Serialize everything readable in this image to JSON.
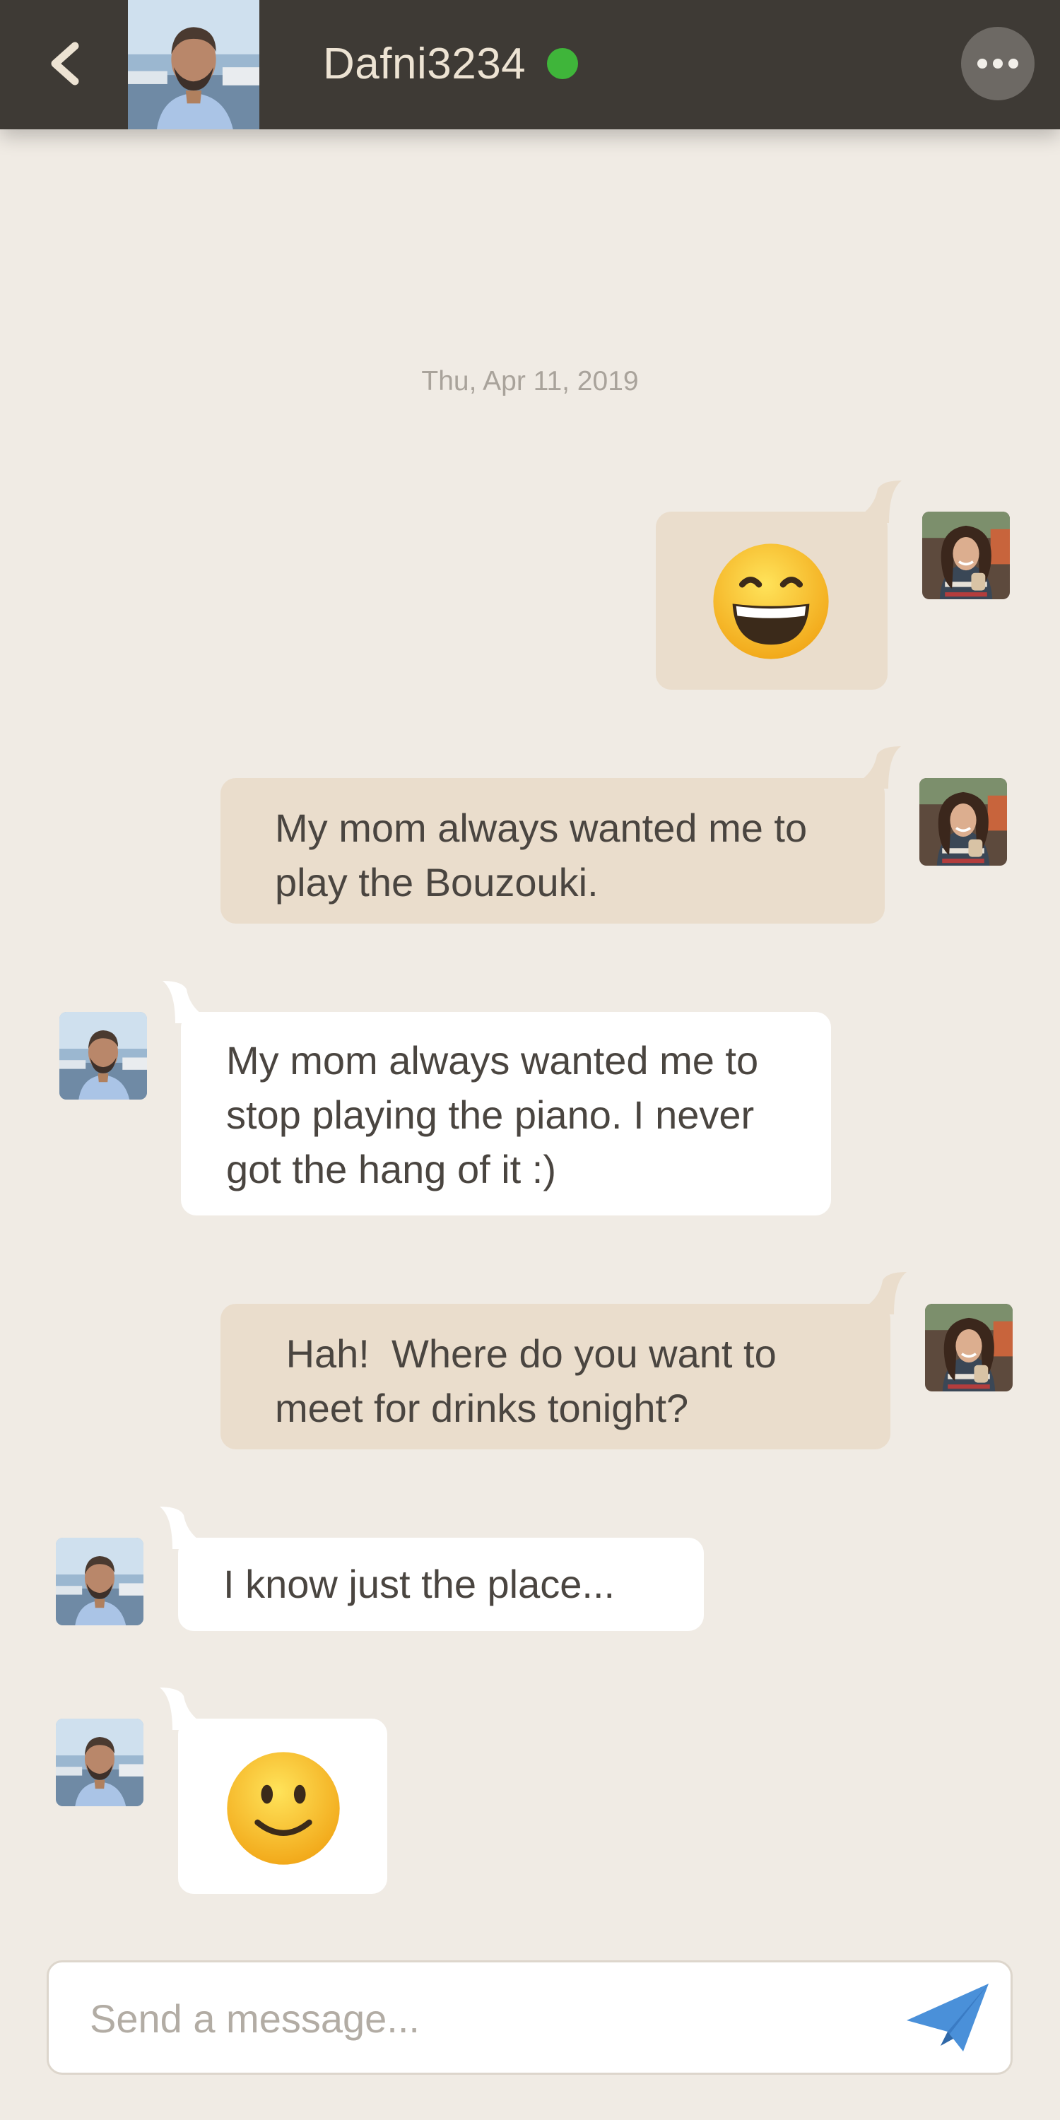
{
  "header": {
    "title": "Dafni3234",
    "back_icon": "chevron-left-icon",
    "more_icon": "more-horizontal-icon",
    "online_color": "#3fb53a"
  },
  "conversation": {
    "date": "Thu, Apr 11, 2019",
    "messages": [
      {
        "from": "me",
        "type": "emoji",
        "icon": "grinning-face-icon"
      },
      {
        "from": "me",
        "type": "text",
        "text": "My mom always wanted me to play the Bouzouki."
      },
      {
        "from": "them",
        "type": "text",
        "text": "My mom always wanted me to stop playing the piano.  I never got the hang of it :)"
      },
      {
        "from": "me",
        "type": "text",
        "text": " Hah!  Where do you want to meet for drinks tonight?"
      },
      {
        "from": "them",
        "type": "text",
        "text": "I know just the place..."
      },
      {
        "from": "them",
        "type": "emoji",
        "icon": "slightly-smiling-face-icon"
      }
    ]
  },
  "composer": {
    "placeholder": "Send a message...",
    "send_icon": "paper-plane-icon"
  },
  "colors": {
    "header_bg": "#3e3a35",
    "page_bg": "#f0ebe4",
    "outgoing_bubble": "#eaddcc",
    "incoming_bubble": "#ffffff",
    "send_icon": "#4a90d9"
  }
}
